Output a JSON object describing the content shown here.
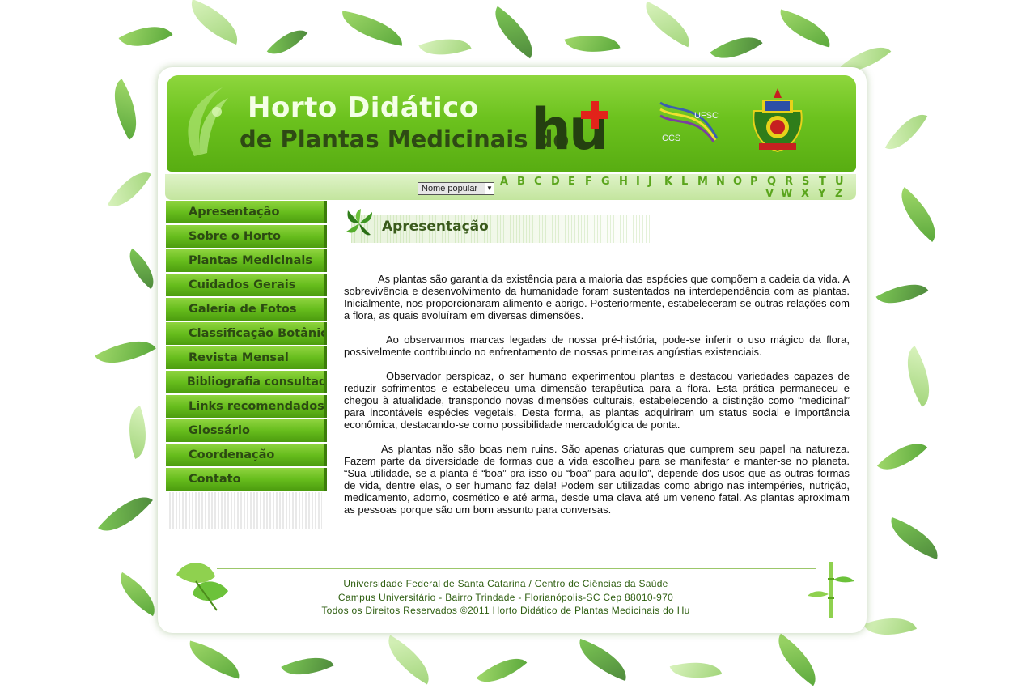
{
  "header": {
    "title_line1": "Horto Didático",
    "title_line2": "de Plantas Medicinais do",
    "logo_text": "hu",
    "ufsc_label": "UFSC",
    "ccs_label": "CCS"
  },
  "search": {
    "select_value": "Nome popular",
    "letters": [
      "A",
      "B",
      "C",
      "D",
      "E",
      "F",
      "G",
      "H",
      "I",
      "J",
      "K",
      "L",
      "M",
      "N",
      "O",
      "P",
      "Q",
      "R",
      "S",
      "T",
      "U",
      "V",
      "W",
      "X",
      "Y",
      "Z"
    ]
  },
  "nav": {
    "items": [
      "Apresentação",
      "Sobre o Horto",
      "Plantas Medicinais",
      "Cuidados Gerais",
      "Galeria de Fotos",
      "Classificação Botânica",
      "Revista Mensal",
      "Bibliografia consultada",
      "Links recomendados",
      "Glossário",
      "Coordenação",
      "Contato"
    ]
  },
  "main": {
    "section_title": "Apresentação",
    "paragraphs": [
      "As plantas são garantia da existência para a maioria das espécies que compõem a cadeia da vida. A sobrevivência e desenvolvimento da humanidade foram sustentados na interdependência com as plantas. Inicialmente, nos proporcionaram alimento e abrigo. Posteriormente, estabeleceram-se outras relações com a flora, as quais evoluíram em diversas dimensões.",
      "Ao observarmos marcas legadas de nossa pré-história, pode-se inferir o uso mágico da flora, possivelmente contribuindo no enfrentamento de nossas primeiras angústias existenciais.",
      "Observador perspicaz, o ser humano experimentou plantas e destacou variedades capazes de reduzir sofrimentos e estabeleceu uma dimensão terapêutica para a flora. Esta prática permaneceu e chegou à atualidade, transpondo novas dimensões culturais, estabelecendo a distinção como “medicinal” para incontáveis espécies vegetais. Desta forma, as plantas adquiriram um status social e importância econômica, destacando-se como possibilidade mercadológica de ponta.",
      "As plantas não são boas nem ruins. São apenas criaturas que cumprem seu papel na natureza. Fazem parte da diversidade de formas que a vida escolheu para se manifestar e manter-se no planeta. “Sua utilidade, se a planta é “boa” pra isso ou “boa” para aquilo”, depende dos usos que as outras formas de vida, dentre elas, o ser humano faz dela! Podem ser utilizadas como abrigo nas intempéries, nutrição, medicamento, adorno, cosmético e até arma, desde uma clava até um veneno fatal. As plantas aproximam as pessoas porque são um bom assunto para conversas."
    ]
  },
  "footer": {
    "line1": "Universidade Federal de Santa Catarina / Centro de Ciências da Saúde",
    "line2": "Campus Universitário - Bairro Trindade - Florianópolis-SC Cep 88010-970",
    "line3": "Todos os Direitos Reservados ©2011 Horto Didático de Plantas Medicinais do Hu"
  },
  "colors": {
    "accent_green": "#6cc21e",
    "dark_green": "#2e4a14",
    "letter_green": "#5aa51c",
    "cross_red": "#e2231a"
  }
}
